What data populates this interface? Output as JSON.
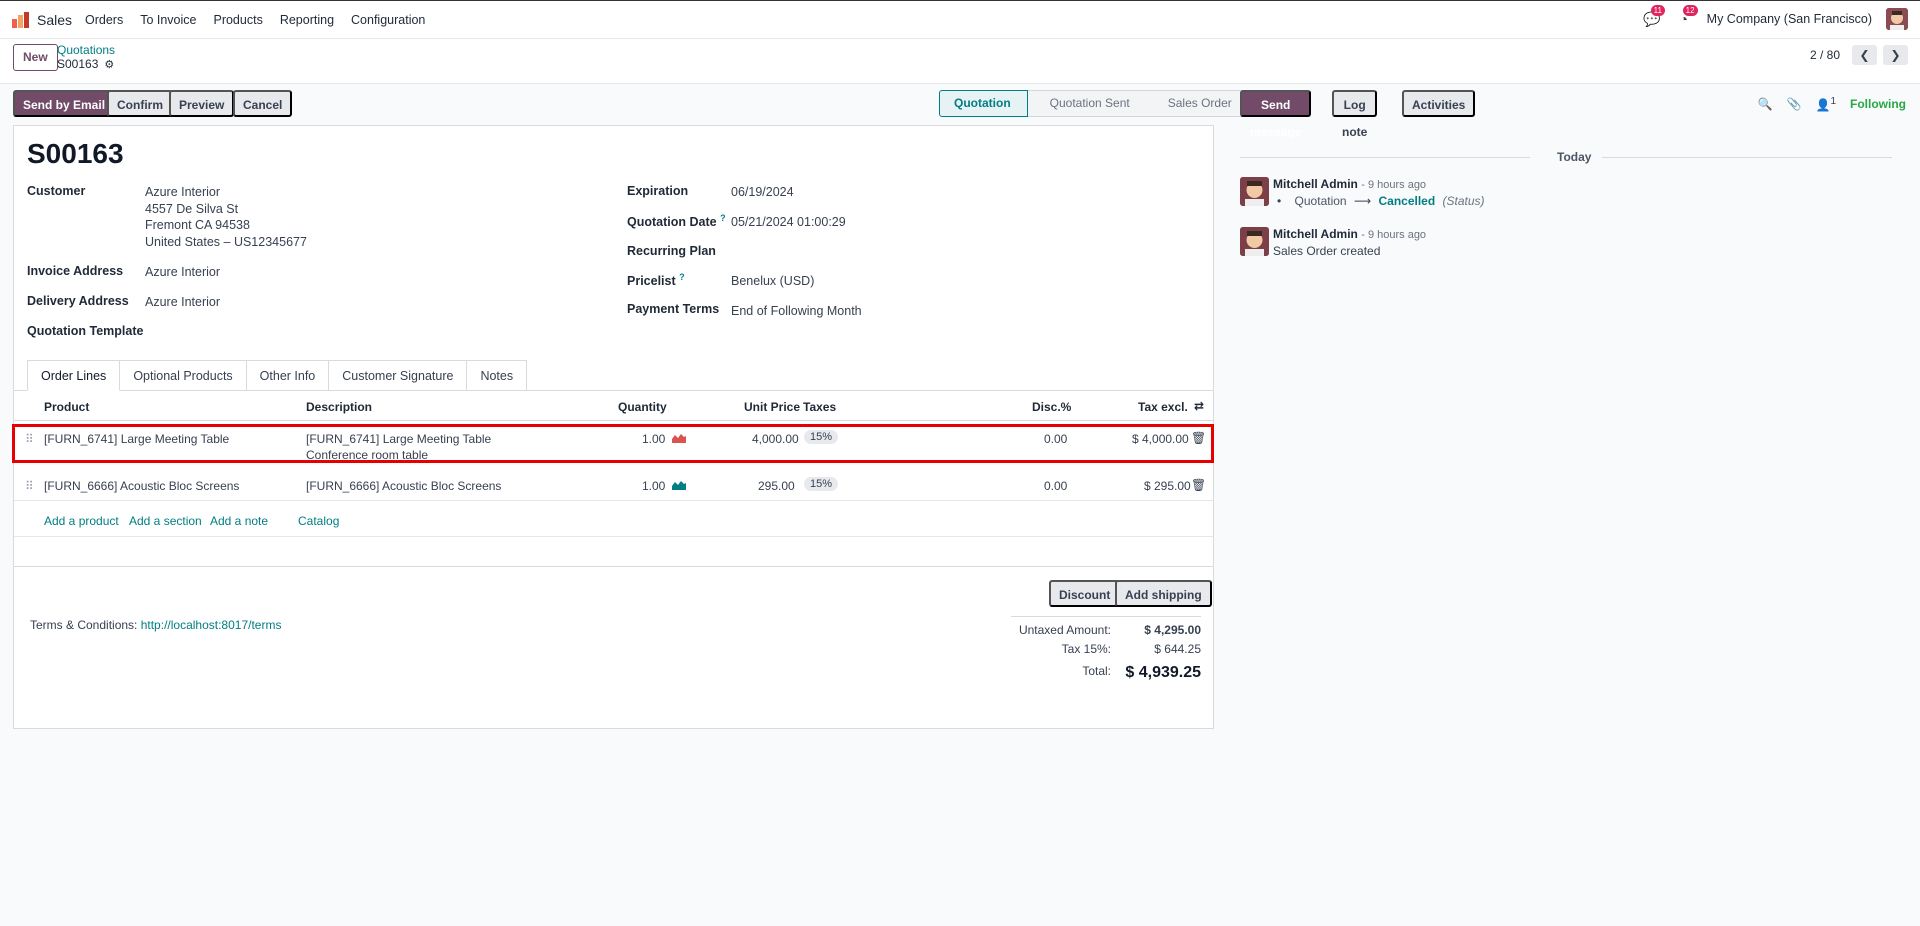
{
  "app": {
    "name": "Sales",
    "menu": [
      "Orders",
      "To Invoice",
      "Products",
      "Reporting",
      "Configuration"
    ],
    "messages_badge": "11",
    "activities_badge": "12",
    "company": "My Company (San Francisco)"
  },
  "control": {
    "new_label": "New",
    "breadcrumb": "Quotations",
    "record_name": "S00163",
    "pager_value": "2 / 80"
  },
  "actions": {
    "send_email": "Send by Email",
    "confirm": "Confirm",
    "preview": "Preview",
    "cancel": "Cancel"
  },
  "status_stages": [
    "Quotation",
    "Quotation Sent",
    "Sales Order"
  ],
  "form": {
    "title": "S00163",
    "customer_label": "Customer",
    "customer_name": "Azure Interior",
    "customer_street": "4557 De Silva St",
    "customer_city": "Fremont CA 94538",
    "customer_country": "United States – US12345677",
    "invoice_address_label": "Invoice Address",
    "invoice_address": "Azure Interior",
    "delivery_address_label": "Delivery Address",
    "delivery_address": "Azure Interior",
    "quotation_template_label": "Quotation Template",
    "expiration_label": "Expiration",
    "expiration": "06/19/2024",
    "quotation_date_label": "Quotation Date",
    "quotation_date": "05/21/2024 01:00:29",
    "recurring_plan_label": "Recurring Plan",
    "pricelist_label": "Pricelist",
    "pricelist": "Benelux (USD)",
    "payment_terms_label": "Payment Terms",
    "payment_terms": "End of Following Month",
    "help_mark": "?"
  },
  "tabs": [
    "Order Lines",
    "Optional Products",
    "Other Info",
    "Customer Signature",
    "Notes"
  ],
  "table": {
    "headers": {
      "product": "Product",
      "description": "Description",
      "quantity": "Quantity",
      "unit_price": "Unit Price",
      "taxes": "Taxes",
      "disc": "Disc.%",
      "tax_excl": "Tax excl."
    },
    "rows": [
      {
        "product": "[FURN_6741] Large Meeting Table",
        "description_line1": "[FURN_6741] Large Meeting Table",
        "description_line2": "Conference room table",
        "quantity": "1.00",
        "unit_price": "4,000.00",
        "tax": "15%",
        "disc": "0.00",
        "subtotal": "$ 4,000.00",
        "forecast_color": "#d9534f"
      },
      {
        "product": "[FURN_6666] Acoustic Bloc Screens",
        "description_line1": "[FURN_6666] Acoustic Bloc Screens",
        "description_line2": "",
        "quantity": "1.00",
        "unit_price": "295.00",
        "tax": "15%",
        "disc": "0.00",
        "subtotal": "$ 295.00",
        "forecast_color": "#017e84"
      }
    ],
    "add_product": "Add a product",
    "add_section": "Add a section",
    "add_note": "Add a note",
    "catalog": "Catalog"
  },
  "footer": {
    "discount": "Discount",
    "add_shipping": "Add shipping",
    "terms_label": "Terms & Conditions:",
    "terms_link": "http://localhost:8017/terms",
    "untaxed_label": "Untaxed Amount:",
    "untaxed_value": "$ 4,295.00",
    "tax_label": "Tax 15%:",
    "tax_value": "$ 644.25",
    "total_label": "Total:",
    "total_value": "$ 4,939.25"
  },
  "chatter": {
    "send_message": "Send message",
    "log_note": "Log note",
    "activities": "Activities",
    "followers_count": "1",
    "following": "Following",
    "today": "Today",
    "messages": [
      {
        "author": "Mitchell Admin",
        "time": "- 9 hours ago",
        "tracking_old": "Quotation",
        "tracking_new": "Cancelled",
        "tracking_field": "(Status)"
      },
      {
        "author": "Mitchell Admin",
        "time": "- 9 hours ago",
        "body": "Sales Order created"
      }
    ]
  }
}
